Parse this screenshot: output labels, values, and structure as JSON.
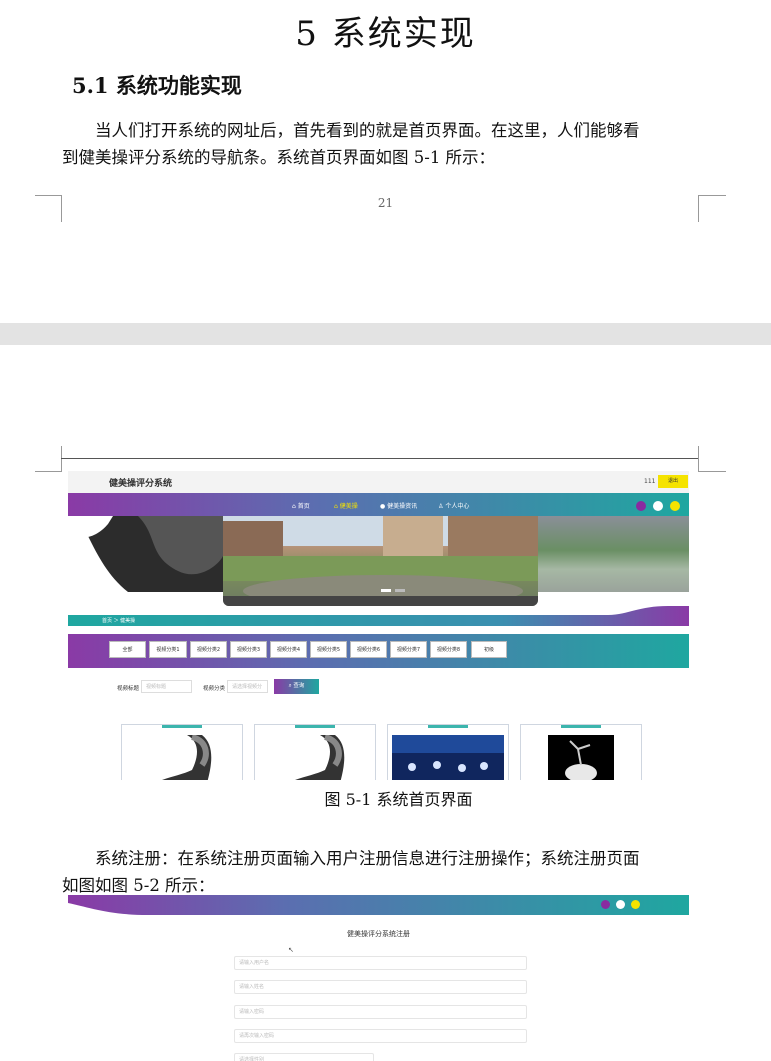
{
  "document": {
    "chapter_title": "5  系统实现",
    "section_title": "5.1 系统功能实现",
    "paragraph1_line1": "当人们打开系统的网址后，首先看到的就是首页界面。在这里，人们能够看",
    "paragraph1_line2": "到健美操评分系统的导航条。系统首页界面如图 5-1 所示：",
    "page_number": "21",
    "figure1_caption": "图 5-1  系统首页界面",
    "paragraph2_line1": "系统注册：在系统注册页面输入用户注册信息进行注册操作；系统注册页面",
    "paragraph2_line2": "如图如图 5-2 所示："
  },
  "figure1": {
    "site_title": "健美操评分系统",
    "user": "111",
    "logout_label": "退出",
    "nav": [
      {
        "icon": "home-icon",
        "label": "首页"
      },
      {
        "icon": "aerobics-icon",
        "label": "健美操"
      },
      {
        "icon": "news-icon",
        "label": "健美操资讯"
      },
      {
        "icon": "user-icon",
        "label": "个人中心"
      }
    ],
    "theme_dots": [
      "#8a2aa0",
      "#ffffff",
      "#f5e300"
    ],
    "breadcrumb": "首页 ＞ 健美操",
    "categories": [
      "全部",
      "视频分类1",
      "视频分类2",
      "视频分类3",
      "视频分类4",
      "视频分类5",
      "视频分类6",
      "视频分类7",
      "视频分类8",
      "初级"
    ],
    "search": {
      "title_label": "视频标题",
      "title_placeholder": "视频标题",
      "category_label": "视频分类",
      "category_placeholder": "请选择视频分",
      "query_label": "查询"
    }
  },
  "figure2": {
    "register_title": "健美操评分系统注册",
    "fields": [
      "请输入用户名",
      "请输入姓名",
      "请输入密码",
      "请再次输入密码",
      "请选择性别"
    ]
  },
  "colors": {
    "purple": "#8a3aa6",
    "teal": "#1fa7a0",
    "yellow": "#f5e300"
  }
}
